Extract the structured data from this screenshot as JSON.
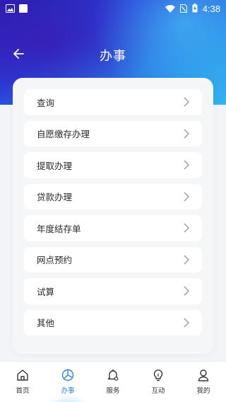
{
  "status_bar": {
    "time": "4:38",
    "icons": [
      "image-icon",
      "square-icon",
      "wifi-icon",
      "no-sim-icon",
      "battery-charging-icon"
    ]
  },
  "header": {
    "title": "办事",
    "back_icon": "arrow-left-icon"
  },
  "menu": {
    "items": [
      {
        "label": "查询"
      },
      {
        "label": "自愿缴存办理"
      },
      {
        "label": "提取办理"
      },
      {
        "label": "贷款办理"
      },
      {
        "label": "年度结存单"
      },
      {
        "label": "网点预约"
      },
      {
        "label": "试算"
      },
      {
        "label": "其他"
      }
    ]
  },
  "tabbar": {
    "active_color": "#2f80ed",
    "tabs": [
      {
        "label": "首页",
        "icon": "home-icon"
      },
      {
        "label": "办事",
        "icon": "pie-chart-icon",
        "active": true
      },
      {
        "label": "服务",
        "icon": "bell-icon"
      },
      {
        "label": "互动",
        "icon": "lightbulb-icon"
      },
      {
        "label": "我的",
        "icon": "user-icon"
      }
    ]
  }
}
